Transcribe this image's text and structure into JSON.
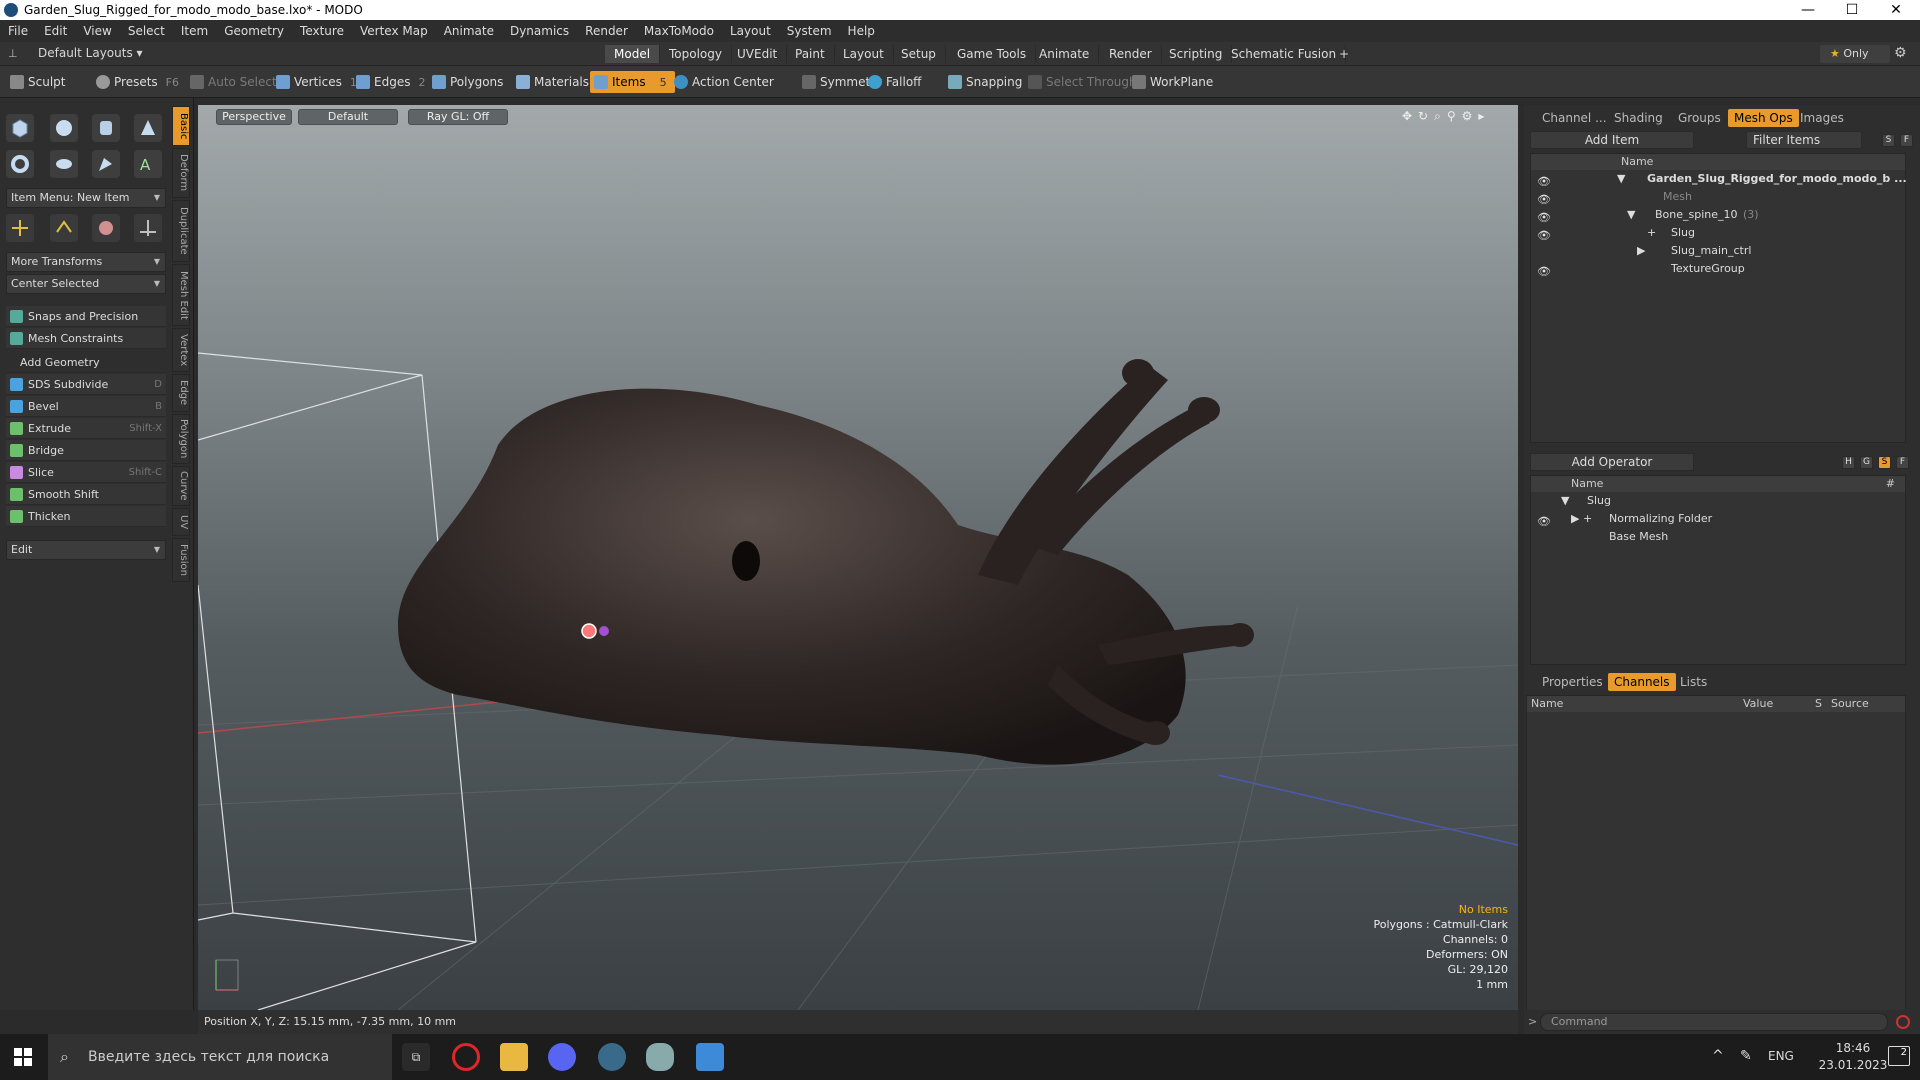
{
  "window": {
    "title": "Garden_Slug_Rigged_for_modo_modo_base.lxo* - MODO"
  },
  "menu": [
    "File",
    "Edit",
    "View",
    "Select",
    "Item",
    "Geometry",
    "Texture",
    "Vertex Map",
    "Animate",
    "Dynamics",
    "Render",
    "MaxToModo",
    "Layout",
    "System",
    "Help"
  ],
  "layoutbar": {
    "default_layouts": "Default Layouts ▾",
    "tabs": [
      "Model",
      "Topology",
      "UVEdit",
      "Paint",
      "Layout",
      "Setup",
      "Game Tools",
      "Animate",
      "Render",
      "Scripting",
      "Schematic Fusion"
    ],
    "add": "+",
    "only": "Only"
  },
  "toolbar": {
    "sculpt": "Sculpt",
    "presets": "Presets",
    "presets_key": "F6",
    "auto_select": "Auto Select",
    "vertices": "Vertices",
    "vertices_n": "1",
    "edges": "Edges",
    "edges_n": "2",
    "polygons": "Polygons",
    "materials": "Materials",
    "items": "Items",
    "items_n": "5",
    "action_center": "Action Center",
    "symmetry": "Symmetry",
    "falloff": "Falloff",
    "snapping": "Snapping",
    "select_through": "Select Through",
    "workplane": "WorkPlane"
  },
  "left": {
    "item_menu": "Item Menu: New Item",
    "more_transforms": "More Transforms",
    "center_selected": "Center Selected",
    "snaps": "Snaps and Precision",
    "mesh_constraints": "Mesh Constraints",
    "add_geometry": "Add Geometry",
    "tools": [
      {
        "label": "SDS Subdivide",
        "key": "D",
        "color": "#4aa3df"
      },
      {
        "label": "Bevel",
        "key": "B",
        "color": "#4aa3df"
      },
      {
        "label": "Extrude",
        "key": "Shift-X",
        "color": "#6cc06c"
      },
      {
        "label": "Bridge",
        "key": "",
        "color": "#6cc06c"
      },
      {
        "label": "Slice",
        "key": "Shift-C",
        "color": "#c98be0"
      },
      {
        "label": "Smooth Shift",
        "key": "",
        "color": "#6cc06c"
      },
      {
        "label": "Thicken",
        "key": "",
        "color": "#6cc06c"
      }
    ],
    "edit": "Edit",
    "vtabs": [
      "Basic",
      "Deform",
      "Duplicate",
      "Mesh Edit",
      "Vertex",
      "Edge",
      "Polygon",
      "Curve",
      "UV",
      "Fusion"
    ]
  },
  "viewport": {
    "perspective": "Perspective",
    "default": "Default",
    "raygl": "Ray GL: Off",
    "hud": {
      "no_items": "No Items",
      "polygons": "Polygons : Catmull-Clark",
      "channels": "Channels: 0",
      "deformers": "Deformers: ON",
      "gl": "GL: 29,120",
      "scale": "1 mm"
    }
  },
  "status": {
    "position": "Position X, Y, Z:  15.15 mm, -7.35 mm, 10 mm"
  },
  "right": {
    "tabs": [
      "Channel ...",
      "Shading",
      "Groups",
      "Mesh Ops",
      "Images"
    ],
    "add_item": "Add Item",
    "filter_items": "Filter Items",
    "s": "S",
    "f": "F",
    "name_col": "Name",
    "items": [
      {
        "label": "Garden_Slug_Rigged_for_modo_modo_b ...",
        "indent": 0,
        "bold": true,
        "dim": false,
        "eye": true,
        "arrow": "▼"
      },
      {
        "label": "Mesh",
        "indent": 1,
        "bold": false,
        "dim": true,
        "eye": true,
        "arrow": ""
      },
      {
        "label": "Bone_spine_10",
        "suffix": "(3)",
        "indent": 1,
        "bold": false,
        "dim": false,
        "eye": true,
        "arrow": "▼"
      },
      {
        "label": "Slug",
        "indent": 2,
        "bold": false,
        "dim": false,
        "eye": true,
        "arrow": "+"
      },
      {
        "label": "Slug_main_ctrl",
        "indent": 2,
        "bold": false,
        "dim": false,
        "eye": false,
        "arrow": "▶"
      },
      {
        "label": "TextureGroup",
        "indent": 2,
        "bold": false,
        "dim": false,
        "eye": true,
        "arrow": ""
      }
    ],
    "add_operator": "Add Operator",
    "op_btns": [
      "H",
      "G",
      "S",
      "F"
    ],
    "hash": "#",
    "ops": [
      {
        "label": "Slug",
        "indent": 0,
        "arrow": "▼",
        "eye": true
      },
      {
        "label": "Normalizing Folder",
        "indent": 1,
        "arrow": "▶ +",
        "eye": true
      },
      {
        "label": "Base Mesh",
        "indent": 1,
        "arrow": "",
        "eye": false
      }
    ],
    "bottom_tabs": [
      "Properties",
      "Channels",
      "Lists"
    ],
    "ch_cols": [
      "Name",
      "Value",
      "S",
      "Source"
    ],
    "command": "Command"
  },
  "taskbar": {
    "search": "Введите здесь текст для поиска",
    "lang": "ENG",
    "time": "18:46",
    "date": "23.01.2023",
    "notif": "2"
  }
}
